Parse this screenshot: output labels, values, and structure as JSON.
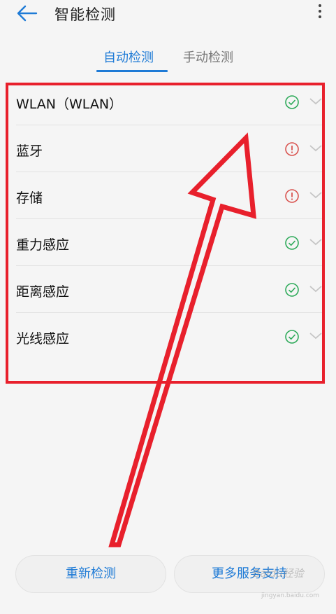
{
  "header": {
    "title": "智能检测",
    "back_icon": "arrow-left-icon",
    "menu_icon": "more-vertical-icon"
  },
  "tabs": [
    {
      "label": "自动检测",
      "active": true
    },
    {
      "label": "手动检测",
      "active": false
    }
  ],
  "items": [
    {
      "label": "WLAN（WLAN）",
      "status": "ok"
    },
    {
      "label": "蓝牙",
      "status": "warning"
    },
    {
      "label": "存储",
      "status": "warning"
    },
    {
      "label": "重力感应",
      "status": "ok"
    },
    {
      "label": "距离感应",
      "status": "ok"
    },
    {
      "label": "光线感应",
      "status": "ok"
    }
  ],
  "buttons": {
    "recheck": "重新检测",
    "more_support": "更多服务支持"
  },
  "watermark": {
    "text": "Baidu经验",
    "url": "jingyan.baidu.com"
  },
  "colors": {
    "accent": "#1f7bd6",
    "ok": "#2eaa5a",
    "warning": "#d9534f",
    "annotation": "#e8202c"
  }
}
